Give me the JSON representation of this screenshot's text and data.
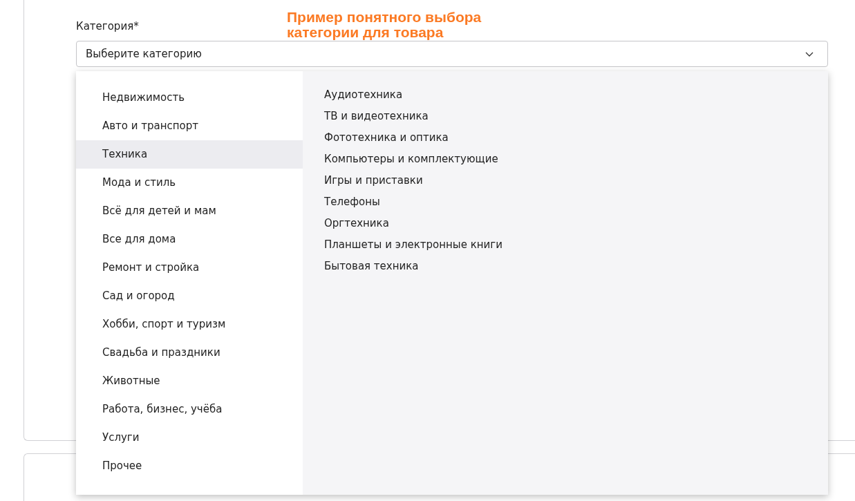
{
  "field": {
    "label": "Категория*",
    "placeholder": "Выберите категорию"
  },
  "annotation": "Пример понятного выбора категории для товара",
  "categories": [
    {
      "label": "Недвижимость",
      "selected": false
    },
    {
      "label": "Авто и транспорт",
      "selected": false
    },
    {
      "label": "Техника",
      "selected": true
    },
    {
      "label": "Мода и стиль",
      "selected": false
    },
    {
      "label": "Всё для детей и мам",
      "selected": false
    },
    {
      "label": "Все для дома",
      "selected": false
    },
    {
      "label": "Ремонт и стройка",
      "selected": false
    },
    {
      "label": "Сад и огород",
      "selected": false
    },
    {
      "label": "Хобби, спорт и туризм",
      "selected": false
    },
    {
      "label": "Свадьба и праздники",
      "selected": false
    },
    {
      "label": "Животные",
      "selected": false
    },
    {
      "label": "Работа, бизнес, учёба",
      "selected": false
    },
    {
      "label": "Услуги",
      "selected": false
    },
    {
      "label": "Прочее",
      "selected": false
    }
  ],
  "subcategories": [
    "Аудиотехника",
    "ТВ и видеотехника",
    "Фототехника и оптика",
    "Компьютеры и комплектующие",
    "Игры и приставки",
    "Телефоны",
    "Оргтехника",
    "Планшеты и электронные книги",
    "Бытовая техника"
  ]
}
